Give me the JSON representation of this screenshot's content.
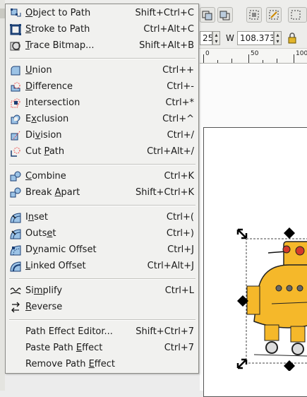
{
  "menu": {
    "items": [
      {
        "pre": "",
        "u": "O",
        "post": "bject to Path",
        "accel": "Shift+Ctrl+C",
        "icon": "object-to-path-icon",
        "highlighted": true
      },
      {
        "pre": "",
        "u": "S",
        "post": "troke to Path",
        "accel": "Ctrl+Alt+C",
        "icon": "stroke-to-path-icon"
      },
      {
        "pre": "",
        "u": "T",
        "post": "race Bitmap...",
        "accel": "Shift+Alt+B",
        "icon": "trace-bitmap-icon"
      },
      {
        "pre": "",
        "u": "U",
        "post": "nion",
        "accel": "Ctrl++",
        "icon": "union-icon"
      },
      {
        "pre": "",
        "u": "D",
        "post": "ifference",
        "accel": "Ctrl+-",
        "icon": "difference-icon"
      },
      {
        "pre": "",
        "u": "I",
        "post": "ntersection",
        "accel": "Ctrl+*",
        "icon": "intersection-icon"
      },
      {
        "pre": "E",
        "u": "x",
        "post": "clusion",
        "accel": "Ctrl+^",
        "icon": "exclusion-icon"
      },
      {
        "pre": "Di",
        "u": "v",
        "post": "ision",
        "accel": "Ctrl+/",
        "icon": "division-icon"
      },
      {
        "pre": "Cut ",
        "u": "P",
        "post": "ath",
        "accel": "Ctrl+Alt+/",
        "icon": "cut-path-icon"
      },
      {
        "pre": "",
        "u": "C",
        "post": "ombine",
        "accel": "Ctrl+K",
        "icon": "combine-icon"
      },
      {
        "pre": "Break ",
        "u": "A",
        "post": "part",
        "accel": "Shift+Ctrl+K",
        "icon": "break-apart-icon"
      },
      {
        "pre": "I",
        "u": "n",
        "post": "set",
        "accel": "Ctrl+(",
        "icon": "inset-icon"
      },
      {
        "pre": "Outs",
        "u": "e",
        "post": "t",
        "accel": "Ctrl+)",
        "icon": "outset-icon"
      },
      {
        "pre": "D",
        "u": "y",
        "post": "namic Offset",
        "accel": "Ctrl+J",
        "icon": "dynamic-offset-icon"
      },
      {
        "pre": "",
        "u": "L",
        "post": "inked Offset",
        "accel": "Ctrl+Alt+J",
        "icon": "linked-offset-icon"
      },
      {
        "pre": "Si",
        "u": "m",
        "post": "plify",
        "accel": "Ctrl+L",
        "icon": "simplify-icon"
      },
      {
        "pre": "",
        "u": "R",
        "post": "everse",
        "accel": "",
        "icon": "reverse-icon"
      },
      {
        "pre": "Path Effect Editor...",
        "u": "",
        "post": "",
        "accel": "Shift+Ctrl+7",
        "icon": ""
      },
      {
        "pre": "Paste Path ",
        "u": "E",
        "post": "ffect",
        "accel": "Ctrl+7",
        "icon": ""
      },
      {
        "pre": "Remove Path ",
        "u": "E",
        "post": "ffect",
        "accel": "",
        "icon": ""
      }
    ]
  },
  "toolbar": {
    "x_value": "25",
    "w_label": "W",
    "w_value": "108.373"
  },
  "ruler": {
    "labels": [
      "0",
      "50",
      "100"
    ]
  },
  "colors": {
    "robot_body": "#f5b82a",
    "robot_eye": "#d43a2a"
  }
}
